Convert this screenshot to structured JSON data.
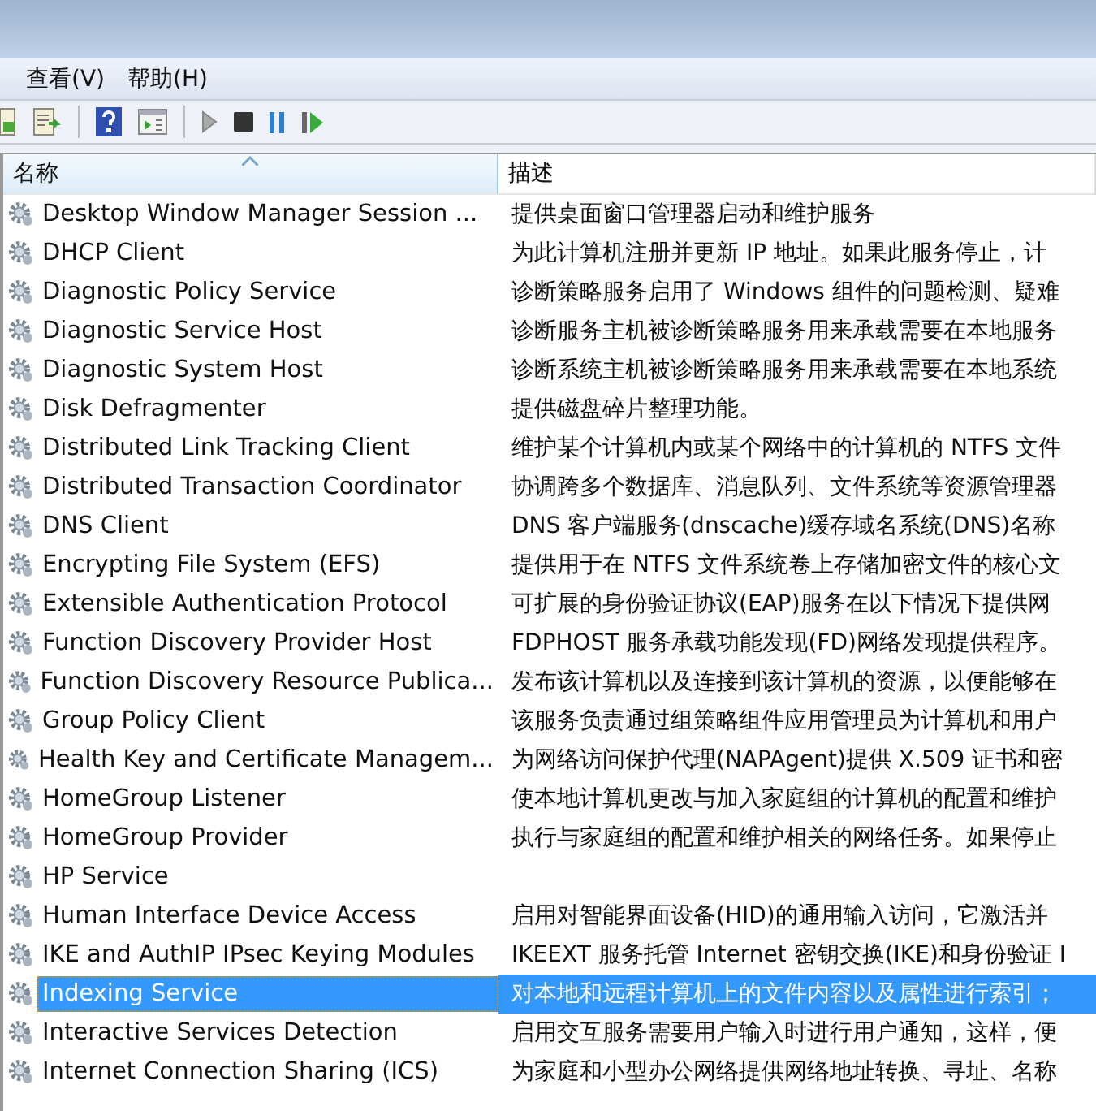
{
  "menu": [
    {
      "label": "查看(V)"
    },
    {
      "label": "帮助(H)"
    }
  ],
  "table": {
    "columns": [
      {
        "label": "名称",
        "sorted": true
      },
      {
        "label": "描述",
        "sorted": false
      }
    ],
    "rows": [
      {
        "name": "Desktop Window Manager Session ...",
        "description": "提供桌面窗口管理器启动和维护服务",
        "selected": false
      },
      {
        "name": "DHCP Client",
        "description": "为此计算机注册并更新 IP 地址。如果此服务停止，计",
        "selected": false
      },
      {
        "name": "Diagnostic Policy Service",
        "description": "诊断策略服务启用了 Windows 组件的问题检测、疑难",
        "selected": false
      },
      {
        "name": "Diagnostic Service Host",
        "description": "诊断服务主机被诊断策略服务用来承载需要在本地服务",
        "selected": false
      },
      {
        "name": "Diagnostic System Host",
        "description": "诊断系统主机被诊断策略服务用来承载需要在本地系统",
        "selected": false
      },
      {
        "name": "Disk Defragmenter",
        "description": "提供磁盘碎片整理功能。",
        "selected": false
      },
      {
        "name": "Distributed Link Tracking Client",
        "description": "维护某个计算机内或某个网络中的计算机的 NTFS 文件",
        "selected": false
      },
      {
        "name": "Distributed Transaction Coordinator",
        "description": "协调跨多个数据库、消息队列、文件系统等资源管理器",
        "selected": false
      },
      {
        "name": "DNS Client",
        "description": "DNS 客户端服务(dnscache)缓存域名系统(DNS)名称",
        "selected": false
      },
      {
        "name": "Encrypting File System (EFS)",
        "description": "提供用于在 NTFS 文件系统卷上存储加密文件的核心文",
        "selected": false
      },
      {
        "name": "Extensible Authentication Protocol",
        "description": "可扩展的身份验证协议(EAP)服务在以下情况下提供网",
        "selected": false
      },
      {
        "name": "Function Discovery Provider Host",
        "description": "FDPHOST 服务承载功能发现(FD)网络发现提供程序。",
        "selected": false
      },
      {
        "name": "Function Discovery Resource Publica...",
        "description": "发布该计算机以及连接到该计算机的资源，以便能够在",
        "selected": false
      },
      {
        "name": "Group Policy Client",
        "description": "该服务负责通过组策略组件应用管理员为计算机和用户",
        "selected": false
      },
      {
        "name": "Health Key and Certificate Managem...",
        "description": "为网络访问保护代理(NAPAgent)提供 X.509 证书和密",
        "selected": false
      },
      {
        "name": "HomeGroup Listener",
        "description": "使本地计算机更改与加入家庭组的计算机的配置和维护",
        "selected": false
      },
      {
        "name": "HomeGroup Provider",
        "description": "执行与家庭组的配置和维护相关的网络任务。如果停止",
        "selected": false
      },
      {
        "name": "HP Service",
        "selected": false
      },
      {
        "name": "Human Interface Device Access",
        "description": "启用对智能界面设备(HID)的通用输入访问，它激活并",
        "selected": false
      },
      {
        "name": "IKE and AuthIP IPsec Keying Modules",
        "description": "IKEEXT 服务托管 Internet 密钥交换(IKE)和身份验证 I",
        "selected": false
      },
      {
        "name": "Indexing Service",
        "description": "对本地和远程计算机上的文件内容以及属性进行索引；",
        "selected": true
      },
      {
        "name": "Interactive Services Detection",
        "description": "启用交互服务需要用户输入时进行用户通知，这样，便",
        "selected": false
      },
      {
        "name": "Internet Connection Sharing (ICS)",
        "description": "为家庭和小型办公网络提供网络地址转换、寻址、名称",
        "selected": false
      }
    ]
  }
}
